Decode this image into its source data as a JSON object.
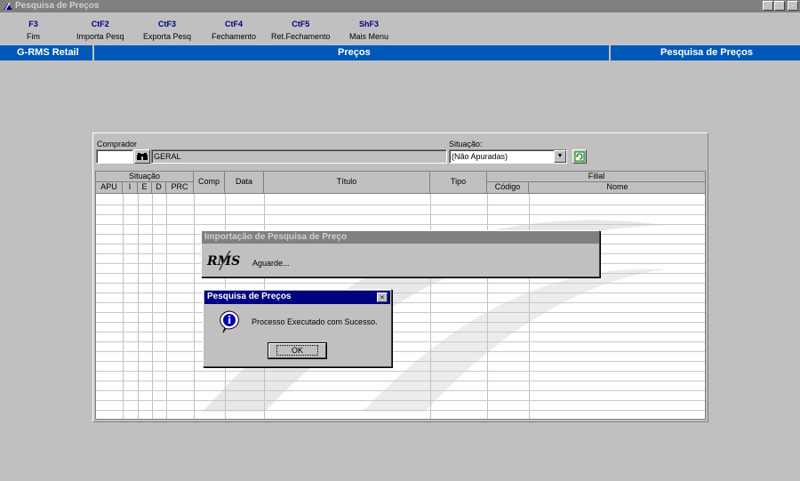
{
  "window": {
    "title": "Pesquisa de Preços"
  },
  "toolbar": [
    {
      "key": "F3",
      "label": "Fim"
    },
    {
      "key": "CtF2",
      "label": "Importa Pesq"
    },
    {
      "key": "CtF3",
      "label": "Exporta Pesq"
    },
    {
      "key": "CtF4",
      "label": "Fechamento"
    },
    {
      "key": "CtF5",
      "label": "Ret.Fechamento"
    },
    {
      "key": "ShF3",
      "label": "Mais Menu"
    }
  ],
  "header": {
    "app": "G-RMS Retail",
    "module": "Preços",
    "screen": "Pesquisa de Preços"
  },
  "filters": {
    "comprador_label": "Comprador",
    "comprador_code": "",
    "comprador_name": "GERAL",
    "situacao_label": "Situação:",
    "situacao_value": "(Não Apuradas)"
  },
  "grid": {
    "group_situacao": "Situação",
    "group_filial": "Filial",
    "cols_situacao": [
      "APU",
      "I",
      "E",
      "D",
      "PRC"
    ],
    "col_comp": "Comp",
    "col_data": "Data",
    "col_titulo": "Título",
    "col_tipo": "Tipo",
    "col_codigo": "Código",
    "col_nome": "Nome",
    "rows": []
  },
  "import_dialog": {
    "title": "Importação de Pesquisa de Preço",
    "logo": "RMS",
    "message": "Aguarde..."
  },
  "message_box": {
    "title": "Pesquisa de Preços",
    "message": "Processo Executado com Sucesso.",
    "ok": "OK",
    "icon": "info-icon"
  },
  "colors": {
    "header_blue": "#0058b8",
    "background": "#c0c0c0",
    "key_color": "#000080"
  }
}
